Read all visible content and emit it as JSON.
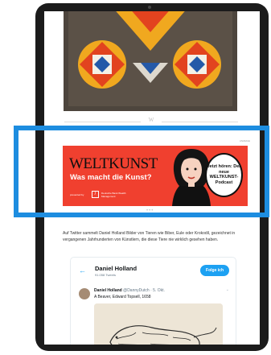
{
  "article": {
    "divider_mark": "W",
    "ad_label": "ANZEIGE",
    "body_text": "Auf Twitter sammelt Daniel Holland Bilder von Tieren wie Biber, Eule oder Krokodil, gezeichnet in vergangenen Jahrhunderten von Künstlern, die diese Tiere nie wirklich gesehen haben."
  },
  "ad": {
    "brand": "WELTKUNST",
    "headline": "Was macht die Kunst?",
    "presented_by": "presented by",
    "sponsor_logo": "/",
    "sponsor_name": "Deutsche Bank Wealth Management",
    "bubble_text": "Jetzt hören: Der neue WELTKUNST-Podcast"
  },
  "twitter": {
    "back_icon": "←",
    "profile_name": "Daniel Holland",
    "tweet_count": "91.058 Tweets",
    "follow_label": "Folge ich",
    "author_name": "Daniel Holland",
    "author_meta": "@DannyDutch · 5. Okt.",
    "tweet_text": "A Beaver, Edward Topsell, 1658",
    "chevron": "⌄"
  },
  "colors": {
    "ad_red": "#f0402f",
    "highlight_blue": "#1d8de0",
    "twitter_blue": "#1da1f2",
    "bezel": "#1b1b1b"
  }
}
